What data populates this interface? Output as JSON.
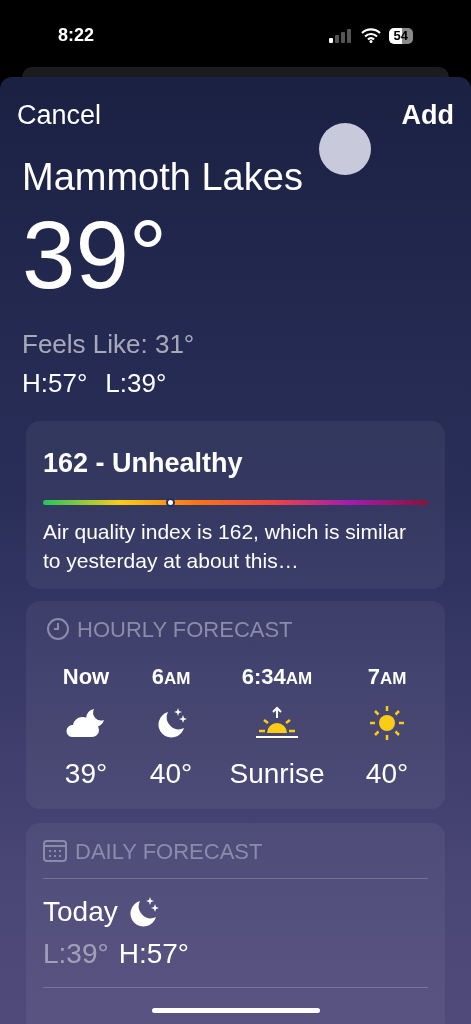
{
  "status_bar": {
    "time": "8:22",
    "battery": "54"
  },
  "nav": {
    "cancel": "Cancel",
    "add": "Add"
  },
  "location": {
    "city": "Mammoth Lakes",
    "temperature": "39°",
    "feels_like": "Feels Like: 31°",
    "high": "H:57°",
    "low": "L:39°"
  },
  "air_quality": {
    "title": "162 - Unhealthy",
    "level": 0.33,
    "description": "Air quality index is 162, which is similar to yesterday at about this…"
  },
  "hourly": {
    "title": "HOURLY FORECAST",
    "items": [
      {
        "time": "Now",
        "kind": "cloud-moon",
        "value": "39°"
      },
      {
        "time": "6",
        "period": "AM",
        "kind": "moon",
        "value": "40°"
      },
      {
        "time": "6:34",
        "period": "AM",
        "kind": "sunrise",
        "value": "Sunrise"
      },
      {
        "time": "7",
        "period": "AM",
        "kind": "sun",
        "value": "40°"
      }
    ]
  },
  "daily": {
    "title": "DAILY FORECAST",
    "days": [
      {
        "day": "Today",
        "kind": "moon",
        "low": "L:39°",
        "high": "H:57°"
      }
    ]
  }
}
